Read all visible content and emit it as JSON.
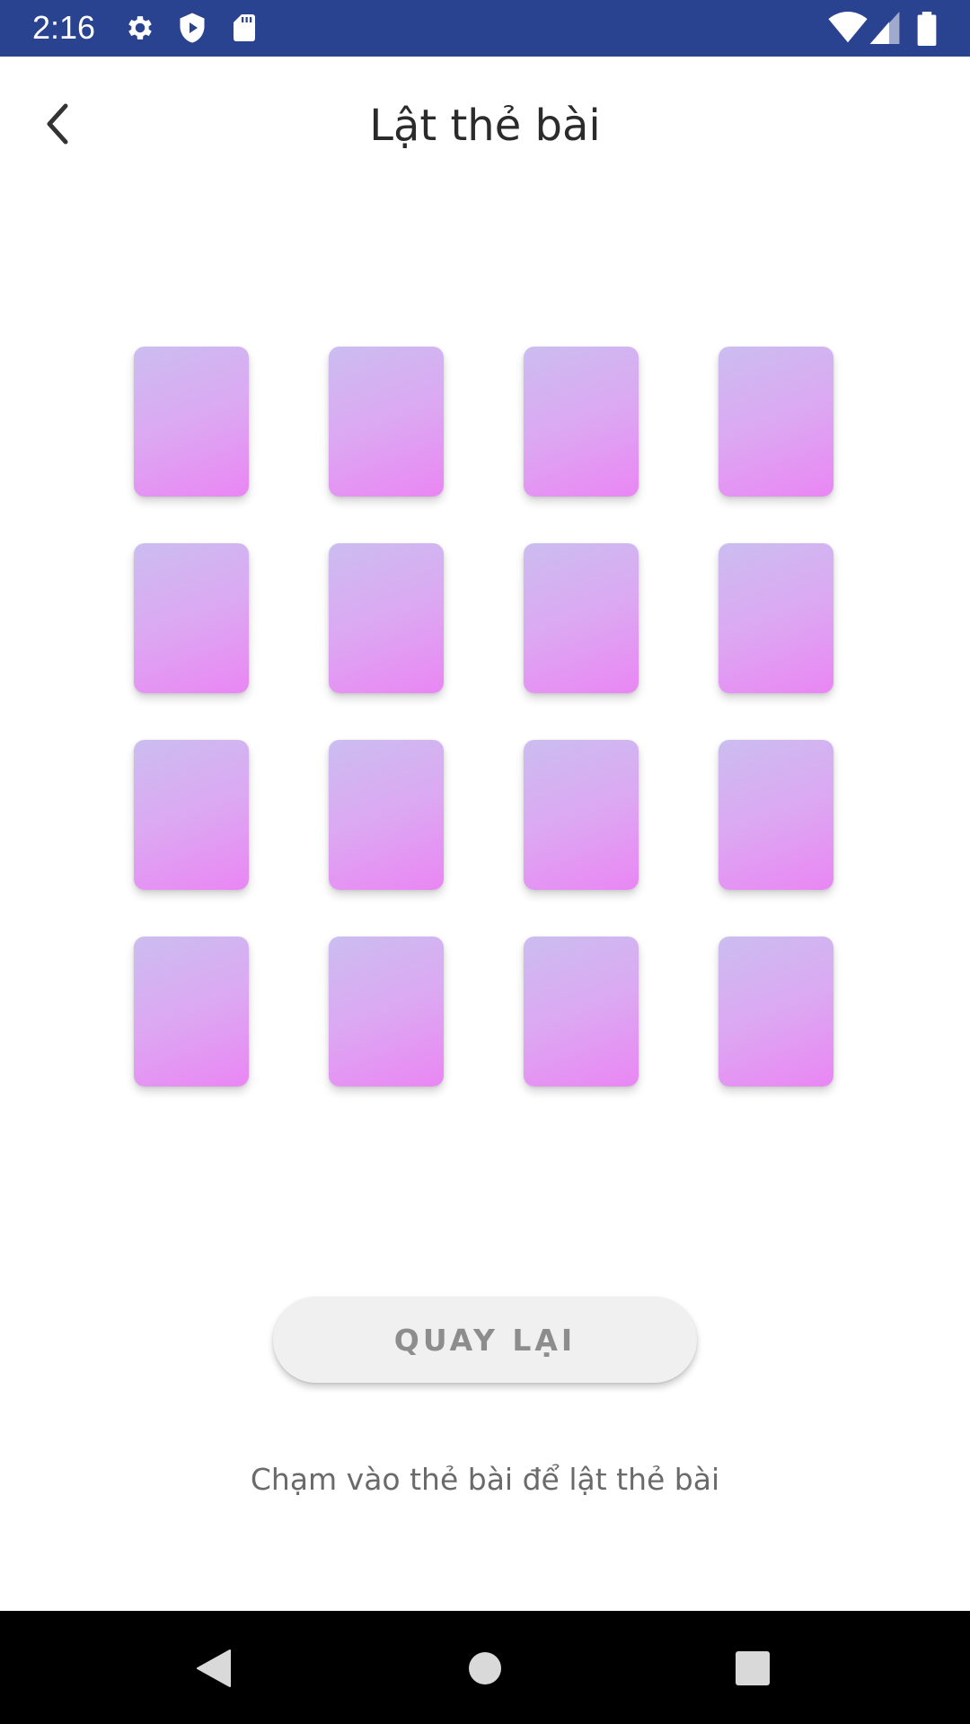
{
  "status_bar": {
    "time": "2:16",
    "icons": [
      "gear-icon",
      "shield-icon",
      "sd-card-icon",
      "wifi-icon",
      "signal-icon",
      "battery-icon"
    ]
  },
  "header": {
    "title": "Lật thẻ bài",
    "back_icon": "chevron-left-icon"
  },
  "cards": {
    "rows": 4,
    "columns": 4,
    "state": "face-down",
    "colors": {
      "gradient_start": "#cbbdf0",
      "gradient_end": "#ea86f4"
    }
  },
  "actions": {
    "return_label": "QUAY LẠI"
  },
  "hint": "Chạm vào thẻ bài để lật thẻ bài",
  "nav_bar": {
    "icons": [
      "back-triangle-icon",
      "home-circle-icon",
      "recents-square-icon"
    ]
  },
  "colors": {
    "status_bar": "#2a4390",
    "title_text": "#2b2b2b",
    "button_bg": "#f0f0f0",
    "button_text": "#8d8d8d",
    "hint_text": "#6a6a6a"
  }
}
